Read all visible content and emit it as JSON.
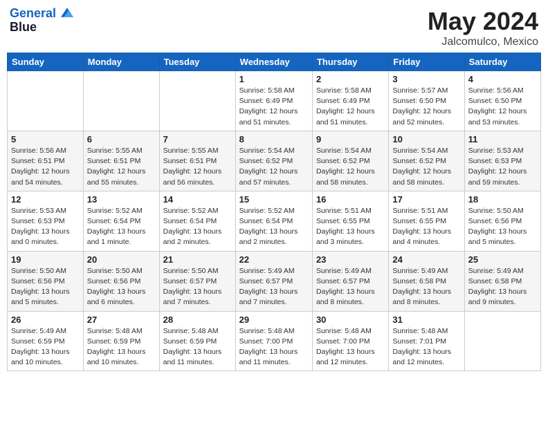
{
  "logo": {
    "line1": "General",
    "line2": "Blue"
  },
  "title": "May 2024",
  "subtitle": "Jalcomulco, Mexico",
  "weekdays": [
    "Sunday",
    "Monday",
    "Tuesday",
    "Wednesday",
    "Thursday",
    "Friday",
    "Saturday"
  ],
  "weeks": [
    [
      {
        "day": "",
        "info": ""
      },
      {
        "day": "",
        "info": ""
      },
      {
        "day": "",
        "info": ""
      },
      {
        "day": "1",
        "info": "Sunrise: 5:58 AM\nSunset: 6:49 PM\nDaylight: 12 hours\nand 51 minutes."
      },
      {
        "day": "2",
        "info": "Sunrise: 5:58 AM\nSunset: 6:49 PM\nDaylight: 12 hours\nand 51 minutes."
      },
      {
        "day": "3",
        "info": "Sunrise: 5:57 AM\nSunset: 6:50 PM\nDaylight: 12 hours\nand 52 minutes."
      },
      {
        "day": "4",
        "info": "Sunrise: 5:56 AM\nSunset: 6:50 PM\nDaylight: 12 hours\nand 53 minutes."
      }
    ],
    [
      {
        "day": "5",
        "info": "Sunrise: 5:56 AM\nSunset: 6:51 PM\nDaylight: 12 hours\nand 54 minutes."
      },
      {
        "day": "6",
        "info": "Sunrise: 5:55 AM\nSunset: 6:51 PM\nDaylight: 12 hours\nand 55 minutes."
      },
      {
        "day": "7",
        "info": "Sunrise: 5:55 AM\nSunset: 6:51 PM\nDaylight: 12 hours\nand 56 minutes."
      },
      {
        "day": "8",
        "info": "Sunrise: 5:54 AM\nSunset: 6:52 PM\nDaylight: 12 hours\nand 57 minutes."
      },
      {
        "day": "9",
        "info": "Sunrise: 5:54 AM\nSunset: 6:52 PM\nDaylight: 12 hours\nand 58 minutes."
      },
      {
        "day": "10",
        "info": "Sunrise: 5:54 AM\nSunset: 6:52 PM\nDaylight: 12 hours\nand 58 minutes."
      },
      {
        "day": "11",
        "info": "Sunrise: 5:53 AM\nSunset: 6:53 PM\nDaylight: 12 hours\nand 59 minutes."
      }
    ],
    [
      {
        "day": "12",
        "info": "Sunrise: 5:53 AM\nSunset: 6:53 PM\nDaylight: 13 hours\nand 0 minutes."
      },
      {
        "day": "13",
        "info": "Sunrise: 5:52 AM\nSunset: 6:54 PM\nDaylight: 13 hours\nand 1 minute."
      },
      {
        "day": "14",
        "info": "Sunrise: 5:52 AM\nSunset: 6:54 PM\nDaylight: 13 hours\nand 2 minutes."
      },
      {
        "day": "15",
        "info": "Sunrise: 5:52 AM\nSunset: 6:54 PM\nDaylight: 13 hours\nand 2 minutes."
      },
      {
        "day": "16",
        "info": "Sunrise: 5:51 AM\nSunset: 6:55 PM\nDaylight: 13 hours\nand 3 minutes."
      },
      {
        "day": "17",
        "info": "Sunrise: 5:51 AM\nSunset: 6:55 PM\nDaylight: 13 hours\nand 4 minutes."
      },
      {
        "day": "18",
        "info": "Sunrise: 5:50 AM\nSunset: 6:56 PM\nDaylight: 13 hours\nand 5 minutes."
      }
    ],
    [
      {
        "day": "19",
        "info": "Sunrise: 5:50 AM\nSunset: 6:56 PM\nDaylight: 13 hours\nand 5 minutes."
      },
      {
        "day": "20",
        "info": "Sunrise: 5:50 AM\nSunset: 6:56 PM\nDaylight: 13 hours\nand 6 minutes."
      },
      {
        "day": "21",
        "info": "Sunrise: 5:50 AM\nSunset: 6:57 PM\nDaylight: 13 hours\nand 7 minutes."
      },
      {
        "day": "22",
        "info": "Sunrise: 5:49 AM\nSunset: 6:57 PM\nDaylight: 13 hours\nand 7 minutes."
      },
      {
        "day": "23",
        "info": "Sunrise: 5:49 AM\nSunset: 6:57 PM\nDaylight: 13 hours\nand 8 minutes."
      },
      {
        "day": "24",
        "info": "Sunrise: 5:49 AM\nSunset: 6:58 PM\nDaylight: 13 hours\nand 8 minutes."
      },
      {
        "day": "25",
        "info": "Sunrise: 5:49 AM\nSunset: 6:58 PM\nDaylight: 13 hours\nand 9 minutes."
      }
    ],
    [
      {
        "day": "26",
        "info": "Sunrise: 5:49 AM\nSunset: 6:59 PM\nDaylight: 13 hours\nand 10 minutes."
      },
      {
        "day": "27",
        "info": "Sunrise: 5:48 AM\nSunset: 6:59 PM\nDaylight: 13 hours\nand 10 minutes."
      },
      {
        "day": "28",
        "info": "Sunrise: 5:48 AM\nSunset: 6:59 PM\nDaylight: 13 hours\nand 11 minutes."
      },
      {
        "day": "29",
        "info": "Sunrise: 5:48 AM\nSunset: 7:00 PM\nDaylight: 13 hours\nand 11 minutes."
      },
      {
        "day": "30",
        "info": "Sunrise: 5:48 AM\nSunset: 7:00 PM\nDaylight: 13 hours\nand 12 minutes."
      },
      {
        "day": "31",
        "info": "Sunrise: 5:48 AM\nSunset: 7:01 PM\nDaylight: 13 hours\nand 12 minutes."
      },
      {
        "day": "",
        "info": ""
      }
    ]
  ]
}
